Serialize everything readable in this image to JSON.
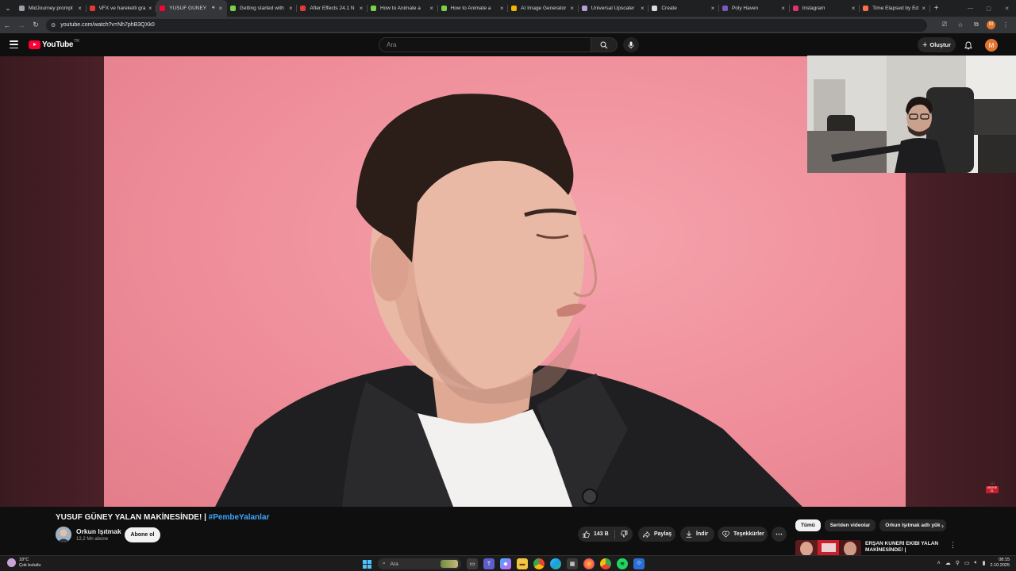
{
  "browser": {
    "tabs": [
      {
        "title": "MidJourney prompt",
        "favicon_color": "#9aa0a6"
      },
      {
        "title": "VFX ve hareketli gra",
        "favicon_color": "#e53935"
      },
      {
        "title": "YUSUF GÜNEY",
        "favicon_color": "#ff0033",
        "active": true
      },
      {
        "title": "Getting started with",
        "favicon_color": "#7bd148"
      },
      {
        "title": "After Effects 24.1 N",
        "favicon_color": "#e53935"
      },
      {
        "title": "How to Animate a",
        "favicon_color": "#7bd148"
      },
      {
        "title": "How to Animate a",
        "favicon_color": "#7bd148"
      },
      {
        "title": "AI Image Generator",
        "favicon_color": "#f4b400"
      },
      {
        "title": "Universal Upscaler",
        "favicon_color": "#b39ddb"
      },
      {
        "title": "Create",
        "favicon_color": "#dcdcdc"
      },
      {
        "title": "Poly Haven",
        "favicon_color": "#7e57c2"
      },
      {
        "title": "Instagram",
        "favicon_color": "#e1306c"
      },
      {
        "title": "Time Elapsed by Ed",
        "favicon_color": "#ff7043"
      }
    ],
    "url": "youtube.com/watch?v=Nh7phB3QXk0"
  },
  "masthead": {
    "logo_text": "YouTube",
    "country_code": "TR",
    "search_placeholder": "Ara",
    "create_label": "Oluştur",
    "avatar_letter": "M"
  },
  "video": {
    "title_main": "YUSUF GÜNEY YALAN MAKİNESİNDE! | ",
    "title_tag": "#PembeYalanlar",
    "watermark_text": "ABONE OL"
  },
  "channel": {
    "name": "Orkun Işıtmak",
    "subscribers": "12,2 Mn abone",
    "subscribe_label": "Abone ol"
  },
  "actions": {
    "likes": "143 B",
    "share": "Paylaş",
    "download": "İndir",
    "thanks": "Teşekkürler"
  },
  "chips": [
    {
      "label": "Tümü",
      "active": true
    },
    {
      "label": "Seriden videolar"
    },
    {
      "label": "Orkun Işıtmak adlı yük"
    }
  ],
  "recommended": {
    "title": "ERŞAN KUNERİ EKİBİ YALAN MAKİNESİNDE! |"
  },
  "taskbar": {
    "temperature": "18°C",
    "weather": "Çok bulutlu",
    "search_placeholder": "Ara",
    "time": "08:15",
    "date": "2.10.2025"
  },
  "colors": {
    "youtube_red": "#ff0033",
    "link_blue": "#3ea6ff",
    "background": "#0f0f0f",
    "video_pink": "#f09aa5"
  }
}
